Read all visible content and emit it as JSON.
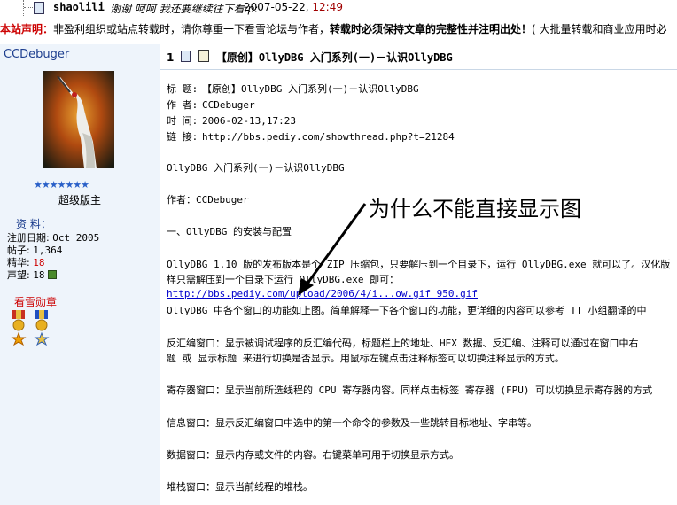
{
  "top_row": {
    "author": "shaolili",
    "title": "谢谢 呵呵 我还要继续往下看:p:",
    "date": "2007-05-22,",
    "time": "12:49"
  },
  "notice": {
    "label": "本站声明：",
    "text1": "非盈利组织或站点转载时，请你尊重一下看雪论坛与作者，",
    "bold": "转载时必须保持文章的完整性并注明出处！",
    "text2": "( 大批量转载和商业应用时必"
  },
  "user": {
    "name": "CCDebuger",
    "stars": "★★★★★★★",
    "rank": "超级版主",
    "profile_header": "资  料：",
    "reg_label": "注册日期:",
    "reg_value": "Oct 2005",
    "posts_label": "帖子:",
    "posts_value": "1,364",
    "essence_label": "精华:",
    "essence_value": "18",
    "reputation_label": "声望:",
    "reputation_value": "18",
    "medals_header": "看雪勋章"
  },
  "post": {
    "floor": "1",
    "heading": "【原创】OllyDBG 入门系列(一)－认识OllyDBG",
    "meta_title_label": "标 题:",
    "meta_title_value": "【原创】OllyDBG 入门系列(一)－认识OllyDBG",
    "meta_author_label": "作 者:",
    "meta_author_value": "CCDebuger",
    "meta_time_label": "时 间:",
    "meta_time_value": "2006-02-13,17:23",
    "meta_link_label": "链 接:",
    "meta_link_value": "http://bbs.pediy.com/showthread.php?t=21284",
    "lines": [
      "OllyDBG 入门系列(一)－认识OllyDBG",
      "作者：CCDebuger",
      "一、OllyDBG 的安装与配置",
      "OllyDBG 1.10 版的发布版本是个 ZIP 压缩包，只要解压到一个目录下，运行 OllyDBG.exe 就可以了。汉化版",
      "样只需解压到一个目录下运行 OllyDBG.exe 即可：",
      "OllyDBG 中各个窗口的功能如上图。简单解释一下各个窗口的功能，更详细的内容可以参考 TT 小组翻译的中",
      "反汇编窗口：显示被调试程序的反汇编代码，标题栏上的地址、HEX 数据、反汇编、注释可以通过在窗口中右",
      "题 或 显示标题 来进行切换是否显示。用鼠标左键点击注释标签可以切换注释显示的方式。",
      "寄存器窗口：显示当前所选线程的 CPU 寄存器内容。同样点击标签 寄存器 (FPU) 可以切换显示寄存器的方式",
      "信息窗口：显示反汇编窗口中选中的第一个命令的参数及一些跳转目标地址、字串等。",
      "数据窗口：显示内存或文件的内容。右键菜单可用于切换显示方式。",
      "堆栈窗口：显示当前线程的堆栈。"
    ],
    "image_link": "http://bbs.pediy.com/upload/2006/4/i...ow.gif 950.gif",
    "annotation": "为什么不能直接显示图"
  },
  "colors": {
    "accent": "#1e3f8f",
    "red": "#cc0000",
    "link": "#0000cc",
    "panel_bg": "#eef4fb"
  }
}
